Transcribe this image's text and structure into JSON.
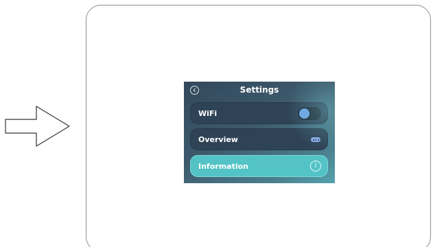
{
  "screen": {
    "title": "Settings",
    "rows": [
      {
        "label": "WiFi",
        "control": "toggle",
        "toggle_on": false
      },
      {
        "label": "Overview",
        "control": "more-icon"
      },
      {
        "label": "Information",
        "control": "info-icon",
        "highlighted": true
      }
    ],
    "info_icon_glyph": "i"
  },
  "colors": {
    "highlight": "#53c3c6",
    "row_background": "#2f4356",
    "toggle_knob": "#6ea1e4"
  },
  "icons": {
    "pointer": "arrow-right-outline-icon",
    "back": "chevron-left-circle-icon",
    "more": "more-dots-icon",
    "info": "info-circle-icon"
  }
}
